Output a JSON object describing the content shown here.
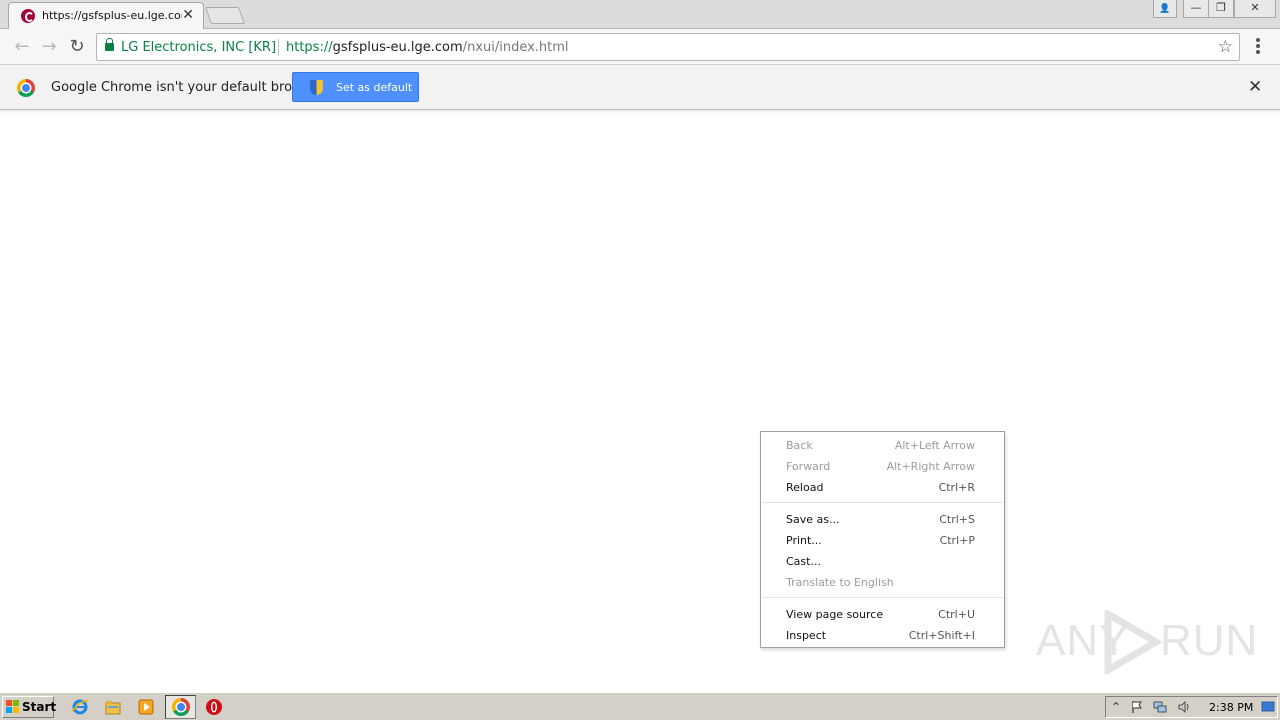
{
  "tab": {
    "title": "https://gsfsplus-eu.lge.com",
    "close_glyph": "✕"
  },
  "window_controls": {
    "user_glyph": "👤",
    "minimize_glyph": "—",
    "restore_glyph": "❐",
    "close_glyph": "✕"
  },
  "toolbar": {
    "back_glyph": "←",
    "forward_glyph": "→",
    "reload_glyph": "↻",
    "star_glyph": "☆"
  },
  "omnibox": {
    "org_name": "LG Electronics, INC [KR]",
    "url_scheme": "https://",
    "url_host": "gsfsplus-eu.lge.com",
    "url_path": "/nxui/index.html"
  },
  "infobar": {
    "message": "Google Chrome isn't your default browser",
    "button_label": "Set as default",
    "close_glyph": "✕"
  },
  "context_menu": {
    "items": [
      {
        "label": "Back",
        "shortcut": "Alt+Left Arrow",
        "enabled": false
      },
      {
        "label": "Forward",
        "shortcut": "Alt+Right Arrow",
        "enabled": false
      },
      {
        "label": "Reload",
        "shortcut": "Ctrl+R",
        "enabled": true
      },
      {
        "label": "Save as...",
        "shortcut": "Ctrl+S",
        "enabled": true
      },
      {
        "label": "Print...",
        "shortcut": "Ctrl+P",
        "enabled": true
      },
      {
        "label": "Cast...",
        "shortcut": "",
        "enabled": true
      },
      {
        "label": "Translate to English",
        "shortcut": "",
        "enabled": false
      },
      {
        "label": "View page source",
        "shortcut": "Ctrl+U",
        "enabled": true
      },
      {
        "label": "Inspect",
        "shortcut": "Ctrl+Shift+I",
        "enabled": true
      }
    ]
  },
  "watermark": {
    "text_left": "ANY",
    "text_right": "RUN"
  },
  "taskbar": {
    "start_label": "Start",
    "clock": "2:38 PM",
    "tray_chevron_glyph": "⌃"
  },
  "colors": {
    "secure_green": "#0b8043",
    "button_blue": "#4d90fe",
    "taskbar_gray": "#d4d0c8"
  }
}
